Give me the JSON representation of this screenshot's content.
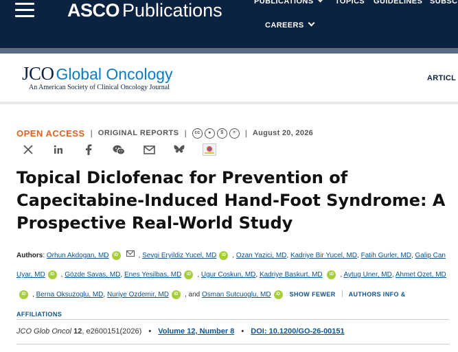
{
  "header": {
    "brand_bold": "ASCO",
    "brand_rest": "Publications",
    "nav": [
      {
        "label": "PUBLICATIONS"
      },
      {
        "label": "TOPICS"
      },
      {
        "label": "GUIDELINES"
      },
      {
        "label": "SUBSCR"
      },
      {
        "label": "CAREERS"
      }
    ]
  },
  "journal": {
    "name_abbr": "JCO",
    "name_rest": "Global Oncology",
    "subtitle": "An American Society of Clinical Oncology Journal",
    "nav_link": "ARTICL"
  },
  "meta": {
    "access": "OPEN ACCESS",
    "category": "ORIGINAL REPORTS",
    "license_icons": [
      "cc-icon",
      "by-icon",
      "nc-icon",
      "nd-icon"
    ],
    "date": "August 20, 2026"
  },
  "share_icons": [
    "x-icon",
    "linkedin-icon",
    "facebook-icon",
    "wechat-icon",
    "email-icon",
    "bluesky-icon",
    "altmetric-icon"
  ],
  "article": {
    "title": "Topical Diclofenac for Prevention of Capecitabine-Induced Hand-Foot Syndrome: A Prospective Real-World Study",
    "authors_label": "Authors",
    "authors": [
      {
        "name": "Orhun Akdogan, MD",
        "orcid": true,
        "email": true
      },
      {
        "name": "Sevgi Eryildiz Yucel, MD",
        "orcid": true
      },
      {
        "name": "Ozan Yazici, MD"
      },
      {
        "name": "Kadriye Bir Yucel, MD"
      },
      {
        "name": "Fatih Gurler, MD"
      },
      {
        "name": "Galip Can Uyar, MD",
        "orcid": true
      },
      {
        "name": "Gözde Savas, MD"
      },
      {
        "name": "Enes Yesilbas, MD",
        "orcid": true
      },
      {
        "name": "Ugur Coskun, MD"
      },
      {
        "name": "Kadriye Baskurt, MD",
        "orcid": true
      },
      {
        "name": "Aytug Uner, MD"
      },
      {
        "name": "Ahmet Ozet, MD",
        "orcid": true
      },
      {
        "name": "Berna Oksuzoglu, MD"
      },
      {
        "name": "Nuriye Ozdemir, MD",
        "orcid": true
      },
      {
        "name": "Osman Sutcuoglu, MD",
        "orcid": true
      }
    ],
    "and_text": ", and",
    "show_fewer": "SHOW FEWER",
    "info_link": "AUTHORS INFO & AFFILIATIONS"
  },
  "citation": {
    "journal_abbr": "JCO Glob Oncol",
    "volume": "12",
    "article_id": ", e2600151(2026)",
    "volume_link": "Volume 12, Number 8",
    "doi_link": "DOI: 10.1200/GO-26-00151"
  },
  "colors": {
    "header_bg": "#0b2341",
    "accent_orange": "#e2611a",
    "link_blue": "#0b5394",
    "orcid_green": "#a6ce39"
  }
}
